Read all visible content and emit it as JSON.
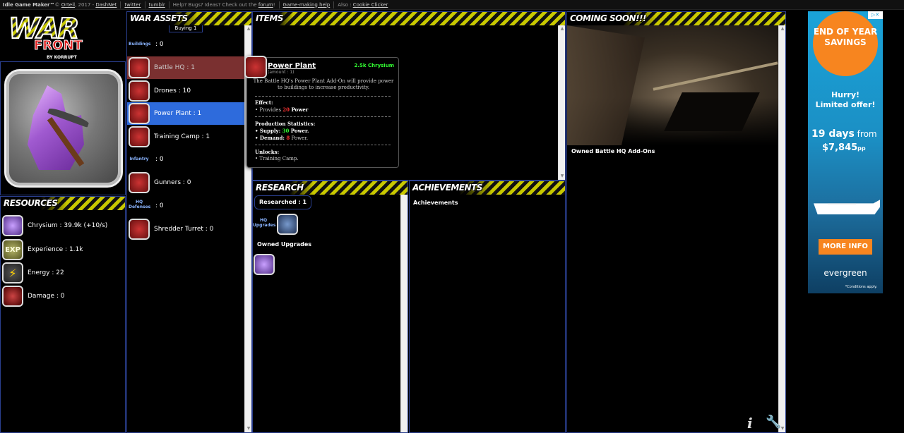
{
  "topbar": {
    "brand": "Idle Game Maker™",
    "copyright_prefix": "© ",
    "author": "Orteil",
    "year_sep": ", 2017 - ",
    "dashnet": "DashNet",
    "twitter": "twitter",
    "tumblr": "tumblr",
    "help_text": "Help? Bugs? Ideas? Check out the ",
    "forum": "forum",
    "forum_end": "!",
    "making_help": "Game-making help",
    "also": "Also : ",
    "cookie_clicker": "Cookie Clicker"
  },
  "logo": {
    "war": "WAR",
    "front": "FRONT",
    "by": "BY KORRUPT"
  },
  "resources": {
    "title": "RESOURCES",
    "items": [
      {
        "label": "Chrysium : 39.9k (+10/s)",
        "icon": "crystal-icon"
      },
      {
        "label": "Experience : 1.1k",
        "icon": "exp-icon",
        "glyph": "EXP"
      },
      {
        "label": "Energy : 22",
        "icon": "energy-icon",
        "glyph": "⚡"
      },
      {
        "label": "Damage : 0",
        "icon": "damage-icon"
      }
    ]
  },
  "war_assets": {
    "title": "WAR ASSETS",
    "buying": "Buying 1",
    "categories": {
      "buildings": {
        "label": "Buildings",
        "value": ": 0"
      },
      "infantry": {
        "label": "Infantry",
        "value": ": 0"
      },
      "hq_defenses": {
        "label": "HQ Defenses",
        "value": ": 0"
      }
    },
    "items": [
      {
        "label": "Battle HQ : 1"
      },
      {
        "label": "Drones : 10"
      },
      {
        "label": "Power Plant : 1"
      },
      {
        "label": "Training Camp : 1"
      },
      {
        "label": "Gunners : 0"
      },
      {
        "label": "Shredder Turret : 0"
      }
    ]
  },
  "items_panel": {
    "title": "ITEMS"
  },
  "tooltip": {
    "name": "Power Plant",
    "amount": "(amount : 1)",
    "cost": "2.5k Chrysium",
    "description": "The Battle HQ's Power Plant Add-On will provide power to buildings to increase productivity.",
    "effect_title": "Effect:",
    "effect_prefix": "• Provides ",
    "effect_value": "20",
    "effect_suffix": " Power",
    "prod_title": "Production Statistics:",
    "supply_prefix": "• Supply: ",
    "supply_value": "30",
    "supply_suffix": " Power.",
    "demand_prefix": "• Demand: ",
    "demand_value": "8",
    "demand_suffix": " Power.",
    "unlocks_title": "Unlocks:",
    "unlocks_item": "• Training Camp."
  },
  "research": {
    "title": "RESEARCH",
    "researched": "Researched : 1",
    "hq_upgrades": "HQ Upgrades",
    "owned_upgrades": "Owned Upgrades"
  },
  "achievements": {
    "title": "ACHIEVEMENTS",
    "label": "Achievements"
  },
  "coming_soon": {
    "title": "COMING SOON!!!",
    "owned_addons": "Owned Battle HQ Add-Ons"
  },
  "ad": {
    "badge": "END OF YEAR SAVINGS",
    "hurry": "Hurry!",
    "limited": "Limited offer!",
    "days": "19 days",
    "from": " from",
    "price": "$7,845",
    "pp": "pp",
    "more_info": "MORE INFO",
    "brand": "evergreen",
    "conditions": "*Conditions apply."
  },
  "colors": {
    "panel_border": "#2a3f8f",
    "selected": "#2e6bdc",
    "dim_row": "#7a3030",
    "hazard_yellow": "#c8c800",
    "green_value": "#33ff33",
    "red_value": "#ff3333",
    "ad_orange": "#f7851f"
  }
}
